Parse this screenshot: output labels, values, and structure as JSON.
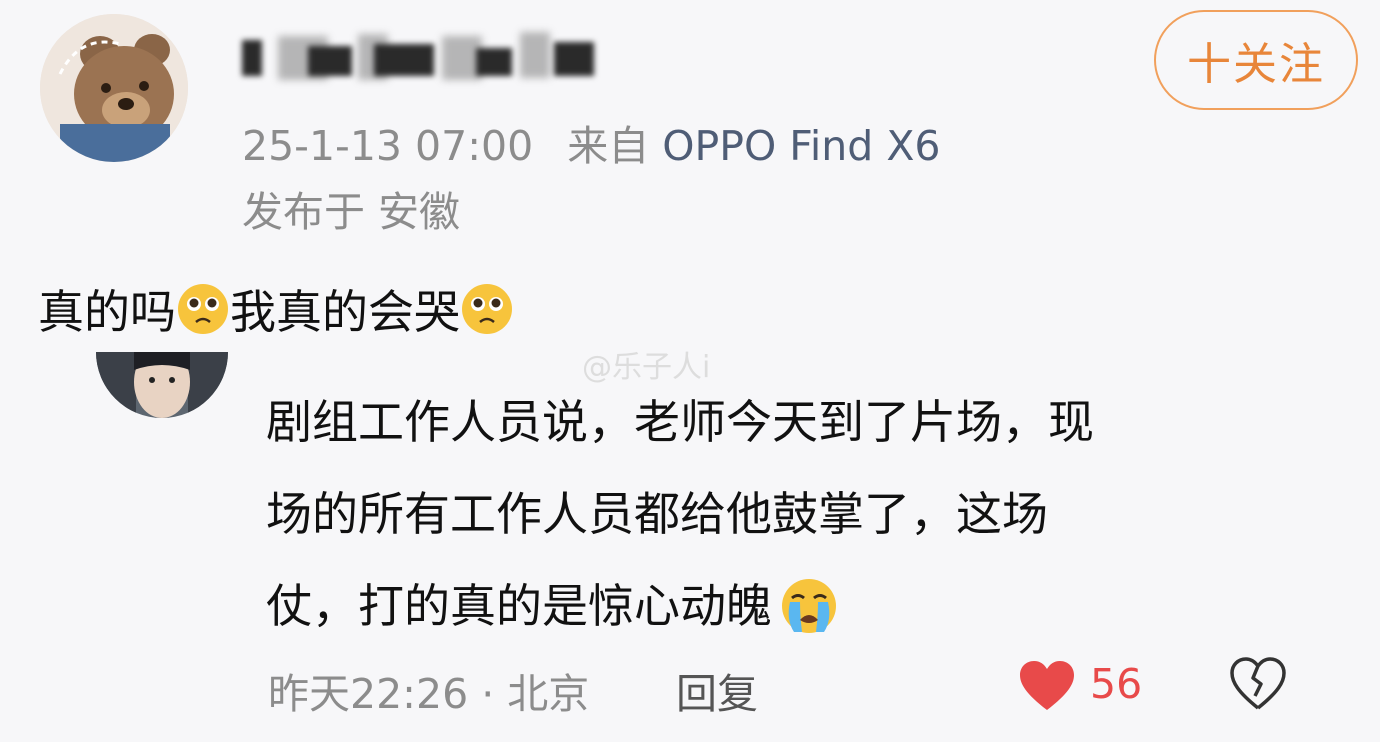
{
  "post": {
    "follow_label": "十关注",
    "timestamp": "25-1-13 07:00",
    "source_prefix": "来自",
    "device": "OPPO Find X6",
    "location": "发布于 安徽",
    "text_part1": "真的吗",
    "text_part2": "我真的会哭"
  },
  "watermark": "@乐子人i",
  "reply": {
    "line1": "剧组工作人员说，老师今天到了片场，现",
    "line2": "场的所有工作人员都给他鼓掌了，这场",
    "line3": "仗，打的真的是惊心动魄",
    "time": "昨天22:26 · 北京",
    "reply_label": "回复",
    "like_count": "56"
  },
  "colors": {
    "accent_orange": "#e8863a",
    "like_red": "#e84a4a",
    "device_blue": "#4f5d76"
  },
  "icons": {
    "post_emoji": "pleading-face",
    "reply_emoji": "loudly-crying-face",
    "like": "heart-filled-icon",
    "dislike": "broken-heart-icon"
  }
}
